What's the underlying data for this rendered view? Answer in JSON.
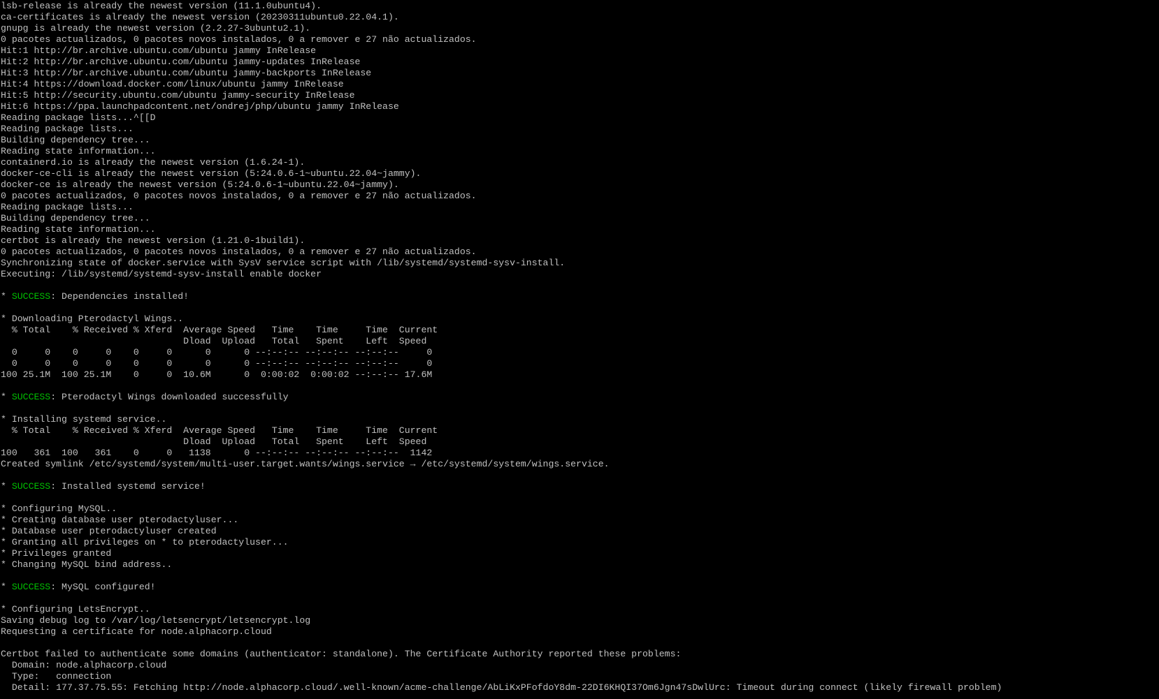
{
  "terminal": {
    "success_color": "#00c000",
    "text_color": "#c0c0c0",
    "background": "#000000",
    "lines": [
      [
        {
          "t": "lsb-release is already the newest version (11.1.0ubuntu4)."
        }
      ],
      [
        {
          "t": "ca-certificates is already the newest version (20230311ubuntu0.22.04.1)."
        }
      ],
      [
        {
          "t": "gnupg is already the newest version (2.2.27-3ubuntu2.1)."
        }
      ],
      [
        {
          "t": "0 pacotes actualizados, 0 pacotes novos instalados, 0 a remover e 27 não actualizados."
        }
      ],
      [
        {
          "t": "Hit:1 http://br.archive.ubuntu.com/ubuntu jammy InRelease"
        }
      ],
      [
        {
          "t": "Hit:2 http://br.archive.ubuntu.com/ubuntu jammy-updates InRelease"
        }
      ],
      [
        {
          "t": "Hit:3 http://br.archive.ubuntu.com/ubuntu jammy-backports InRelease"
        }
      ],
      [
        {
          "t": "Hit:4 https://download.docker.com/linux/ubuntu jammy InRelease"
        }
      ],
      [
        {
          "t": "Hit:5 http://security.ubuntu.com/ubuntu jammy-security InRelease"
        }
      ],
      [
        {
          "t": "Hit:6 https://ppa.launchpadcontent.net/ondrej/php/ubuntu jammy InRelease"
        }
      ],
      [
        {
          "t": "Reading package lists...^[[D"
        }
      ],
      [
        {
          "t": "Reading package lists..."
        }
      ],
      [
        {
          "t": "Building dependency tree..."
        }
      ],
      [
        {
          "t": "Reading state information..."
        }
      ],
      [
        {
          "t": "containerd.io is already the newest version (1.6.24-1)."
        }
      ],
      [
        {
          "t": "docker-ce-cli is already the newest version (5:24.0.6-1~ubuntu.22.04~jammy)."
        }
      ],
      [
        {
          "t": "docker-ce is already the newest version (5:24.0.6-1~ubuntu.22.04~jammy)."
        }
      ],
      [
        {
          "t": "0 pacotes actualizados, 0 pacotes novos instalados, 0 a remover e 27 não actualizados."
        }
      ],
      [
        {
          "t": "Reading package lists..."
        }
      ],
      [
        {
          "t": "Building dependency tree..."
        }
      ],
      [
        {
          "t": "Reading state information..."
        }
      ],
      [
        {
          "t": "certbot is already the newest version (1.21.0-1build1)."
        }
      ],
      [
        {
          "t": "0 pacotes actualizados, 0 pacotes novos instalados, 0 a remover e 27 não actualizados."
        }
      ],
      [
        {
          "t": "Synchronizing state of docker.service with SysV service script with /lib/systemd/systemd-sysv-install."
        }
      ],
      [
        {
          "t": "Executing: /lib/systemd/systemd-sysv-install enable docker"
        }
      ],
      [
        {
          "t": ""
        }
      ],
      [
        {
          "t": "* "
        },
        {
          "t": "SUCCESS",
          "c": "success"
        },
        {
          "t": ": Dependencies installed!"
        }
      ],
      [
        {
          "t": ""
        }
      ],
      [
        {
          "t": "* Downloading Pterodactyl Wings.."
        }
      ],
      [
        {
          "t": "  % Total    % Received % Xferd  Average Speed   Time    Time     Time  Current"
        }
      ],
      [
        {
          "t": "                                 Dload  Upload   Total   Spent    Left  Speed"
        }
      ],
      [
        {
          "t": "  0     0    0     0    0     0      0      0 --:--:-- --:--:-- --:--:--     0"
        }
      ],
      [
        {
          "t": "  0     0    0     0    0     0      0      0 --:--:-- --:--:-- --:--:--     0"
        }
      ],
      [
        {
          "t": "100 25.1M  100 25.1M    0     0  10.6M      0  0:00:02  0:00:02 --:--:-- 17.6M"
        }
      ],
      [
        {
          "t": ""
        }
      ],
      [
        {
          "t": "* "
        },
        {
          "t": "SUCCESS",
          "c": "success"
        },
        {
          "t": ": Pterodactyl Wings downloaded successfully"
        }
      ],
      [
        {
          "t": ""
        }
      ],
      [
        {
          "t": "* Installing systemd service.."
        }
      ],
      [
        {
          "t": "  % Total    % Received % Xferd  Average Speed   Time    Time     Time  Current"
        }
      ],
      [
        {
          "t": "                                 Dload  Upload   Total   Spent    Left  Speed"
        }
      ],
      [
        {
          "t": "100   361  100   361    0     0   1138      0 --:--:-- --:--:-- --:--:--  1142"
        }
      ],
      [
        {
          "t": "Created symlink /etc/systemd/system/multi-user.target.wants/wings.service → /etc/systemd/system/wings.service."
        }
      ],
      [
        {
          "t": ""
        }
      ],
      [
        {
          "t": "* "
        },
        {
          "t": "SUCCESS",
          "c": "success"
        },
        {
          "t": ": Installed systemd service!"
        }
      ],
      [
        {
          "t": ""
        }
      ],
      [
        {
          "t": "* Configuring MySQL.."
        }
      ],
      [
        {
          "t": "* Creating database user pterodactyluser..."
        }
      ],
      [
        {
          "t": "* Database user pterodactyluser created"
        }
      ],
      [
        {
          "t": "* Granting all privileges on * to pterodactyluser..."
        }
      ],
      [
        {
          "t": "* Privileges granted"
        }
      ],
      [
        {
          "t": "* Changing MySQL bind address.."
        }
      ],
      [
        {
          "t": ""
        }
      ],
      [
        {
          "t": "* "
        },
        {
          "t": "SUCCESS",
          "c": "success"
        },
        {
          "t": ": MySQL configured!"
        }
      ],
      [
        {
          "t": ""
        }
      ],
      [
        {
          "t": "* Configuring LetsEncrypt.."
        }
      ],
      [
        {
          "t": "Saving debug log to /var/log/letsencrypt/letsencrypt.log"
        }
      ],
      [
        {
          "t": "Requesting a certificate for node.alphacorp.cloud"
        }
      ],
      [
        {
          "t": ""
        }
      ],
      [
        {
          "t": "Certbot failed to authenticate some domains (authenticator: standalone). The Certificate Authority reported these problems:"
        }
      ],
      [
        {
          "t": "  Domain: node.alphacorp.cloud"
        }
      ],
      [
        {
          "t": "  Type:   connection"
        }
      ],
      [
        {
          "t": "  Detail: 177.37.75.55: Fetching http://node.alphacorp.cloud/.well-known/acme-challenge/AbLiKxPFofdoY8dm-22DI6KHQI37Om6Jgn47sDwlUrc: Timeout during connect (likely firewall problem)"
        }
      ]
    ]
  }
}
